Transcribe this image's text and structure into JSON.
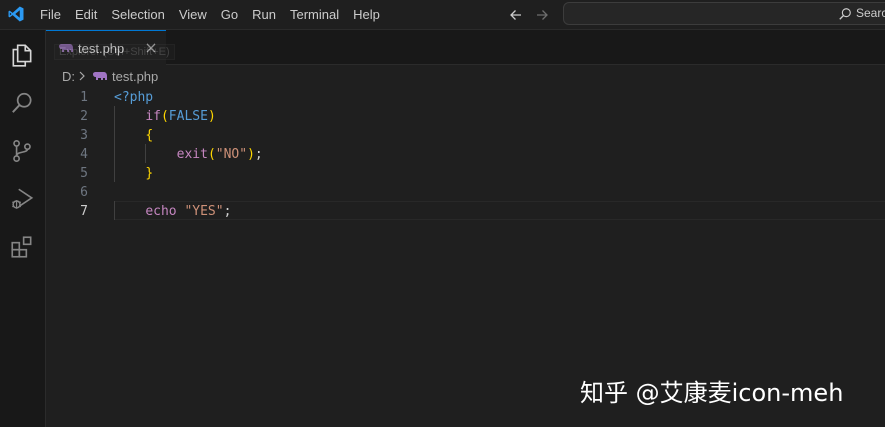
{
  "titlebar": {
    "menu": [
      "File",
      "Edit",
      "Selection",
      "View",
      "Go",
      "Run",
      "Terminal",
      "Help"
    ],
    "search_label": "Searc",
    "icons": [
      "vscode-logo",
      "arrow-left-icon",
      "arrow-right-icon",
      "search-icon"
    ]
  },
  "activitybar": {
    "items": [
      "explorer-icon",
      "search-icon",
      "source-control-icon",
      "run-debug-icon",
      "extensions-icon"
    ]
  },
  "tabs": [
    {
      "label": "test.php",
      "active": true,
      "icon": "php-elephant-icon"
    }
  ],
  "tooltip": "Explorer (Ctrl+Shift+E)",
  "breadcrumb": {
    "drive": "D:",
    "file": "test.php"
  },
  "editor": {
    "line_numbers": [
      "1",
      "2",
      "3",
      "4",
      "5",
      "6",
      "7"
    ],
    "current_line": 7,
    "lines": [
      [
        {
          "t": "tag",
          "v": "<?php"
        }
      ],
      [
        {
          "t": "plain",
          "v": "    "
        },
        {
          "t": "kw",
          "v": "if"
        },
        {
          "t": "paren",
          "v": "("
        },
        {
          "t": "const",
          "v": "FALSE"
        },
        {
          "t": "paren",
          "v": ")"
        }
      ],
      [
        {
          "t": "plain",
          "v": "    "
        },
        {
          "t": "brace",
          "v": "{"
        }
      ],
      [
        {
          "t": "plain",
          "v": "        "
        },
        {
          "t": "kw",
          "v": "exit"
        },
        {
          "t": "paren",
          "v": "("
        },
        {
          "t": "str",
          "v": "\"NO\""
        },
        {
          "t": "paren",
          "v": ")"
        },
        {
          "t": "plain",
          "v": ";"
        }
      ],
      [
        {
          "t": "plain",
          "v": "    "
        },
        {
          "t": "brace",
          "v": "}"
        }
      ],
      [],
      [
        {
          "t": "plain",
          "v": "    "
        },
        {
          "t": "kw",
          "v": "echo"
        },
        {
          "t": "plain",
          "v": " "
        },
        {
          "t": "str",
          "v": "\"YES\""
        },
        {
          "t": "plain",
          "v": ";"
        }
      ]
    ]
  },
  "watermark": "知乎 @艾康麦icon-meh",
  "colors": {
    "accent": "#0078d4",
    "background": "#1f1f1f",
    "php_icon": "#a074c4"
  }
}
